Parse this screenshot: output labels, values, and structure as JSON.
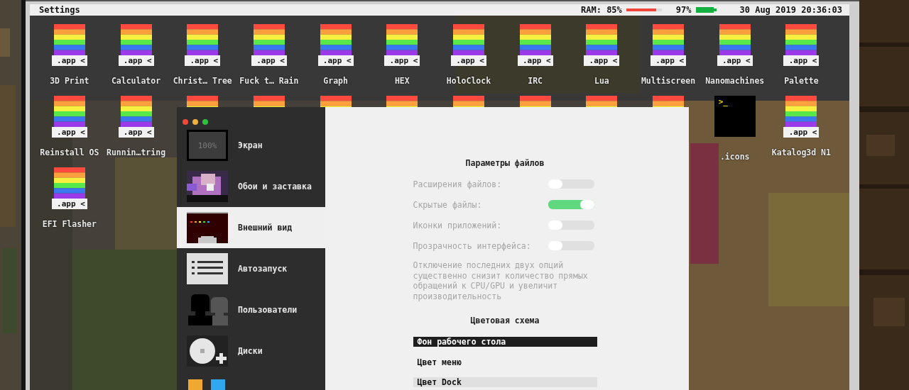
{
  "top_bar": {
    "title": "Settings",
    "ram_label": "RAM: 85%",
    "ram": {
      "level": 0.85
    },
    "battery_text": "97%",
    "clock": "30 Aug 2019 20:36:03"
  },
  "desktop": {
    "icons": [
      {
        "kind": "app",
        "badge": ".app <",
        "label": "3D Print"
      },
      {
        "kind": "app",
        "badge": ".app <",
        "label": "Calculator"
      },
      {
        "kind": "app",
        "badge": ".app <",
        "label": "Christ… Tree"
      },
      {
        "kind": "app",
        "badge": ".app <",
        "label": "Fuck t… Rain"
      },
      {
        "kind": "app",
        "badge": ".app <",
        "label": "Graph"
      },
      {
        "kind": "app",
        "badge": ".app <",
        "label": "HEX"
      },
      {
        "kind": "app",
        "badge": ".app <",
        "label": "HoloClock"
      },
      {
        "kind": "app",
        "badge": ".app <",
        "label": "IRC"
      },
      {
        "kind": "app",
        "badge": ".app <",
        "label": "Lua"
      },
      {
        "kind": "app",
        "badge": ".app <",
        "label": "Multiscreen"
      },
      {
        "kind": "app",
        "badge": ".app <",
        "label": "Nanomachines"
      },
      {
        "kind": "app",
        "badge": ".app <",
        "label": "Palette"
      },
      {
        "kind": "app",
        "badge": ".app <",
        "label": "Reinstall OS"
      },
      {
        "kind": "app",
        "badge": ".app <",
        "label": "Runnin…tring"
      },
      {
        "kind": "app"
      },
      {
        "kind": "app"
      },
      {
        "kind": "app"
      },
      {
        "kind": "app"
      },
      {
        "kind": "app"
      },
      {
        "kind": "app"
      },
      {
        "kind": "app"
      },
      {
        "kind": "app"
      },
      {
        "kind": "terminal",
        "glyph": ">_",
        "label": ".icons"
      },
      {
        "kind": "app",
        "badge": ".app <",
        "label": "Katalog3d N1"
      },
      {
        "kind": "app",
        "badge": ".app <",
        "label": "EFI Flasher"
      }
    ]
  },
  "settings_window": {
    "sidebar": [
      {
        "kind": "screen",
        "icon_text": "100%",
        "label": "Экран",
        "selected": false
      },
      {
        "kind": "wallpaper",
        "label": "Обои и заставка",
        "selected": false
      },
      {
        "kind": "appearance",
        "label": "Внешний вид",
        "selected": true
      },
      {
        "kind": "autorun",
        "label": "Автозапуск",
        "selected": false
      },
      {
        "kind": "users",
        "label": "Пользователи",
        "selected": false
      },
      {
        "kind": "disks",
        "label": "Диски",
        "selected": false
      },
      {
        "kind": "apps",
        "selected": false
      }
    ],
    "files_title": "Параметры файлов",
    "toggles": [
      {
        "label": "Расширения файлов:",
        "on": false
      },
      {
        "label": "Скрытые файлы:",
        "on": true
      },
      {
        "label": "Иконки приложений:",
        "on": false
      },
      {
        "label": "Прозрачность интерфейса:",
        "on": false
      }
    ],
    "note": "Отключение последних двух опций существенно снизит количество прямых обращений к CPU/GPU и увеличит производительность",
    "scheme_title": "Цветовая схема",
    "colors": [
      {
        "label": "Фон рабочего стола",
        "color": "#1e1e1e"
      },
      {
        "label": "Цвет меню",
        "color": "#f0f0f0"
      },
      {
        "label": "Цвет Dock",
        "color": "#e0e0e0"
      }
    ]
  }
}
